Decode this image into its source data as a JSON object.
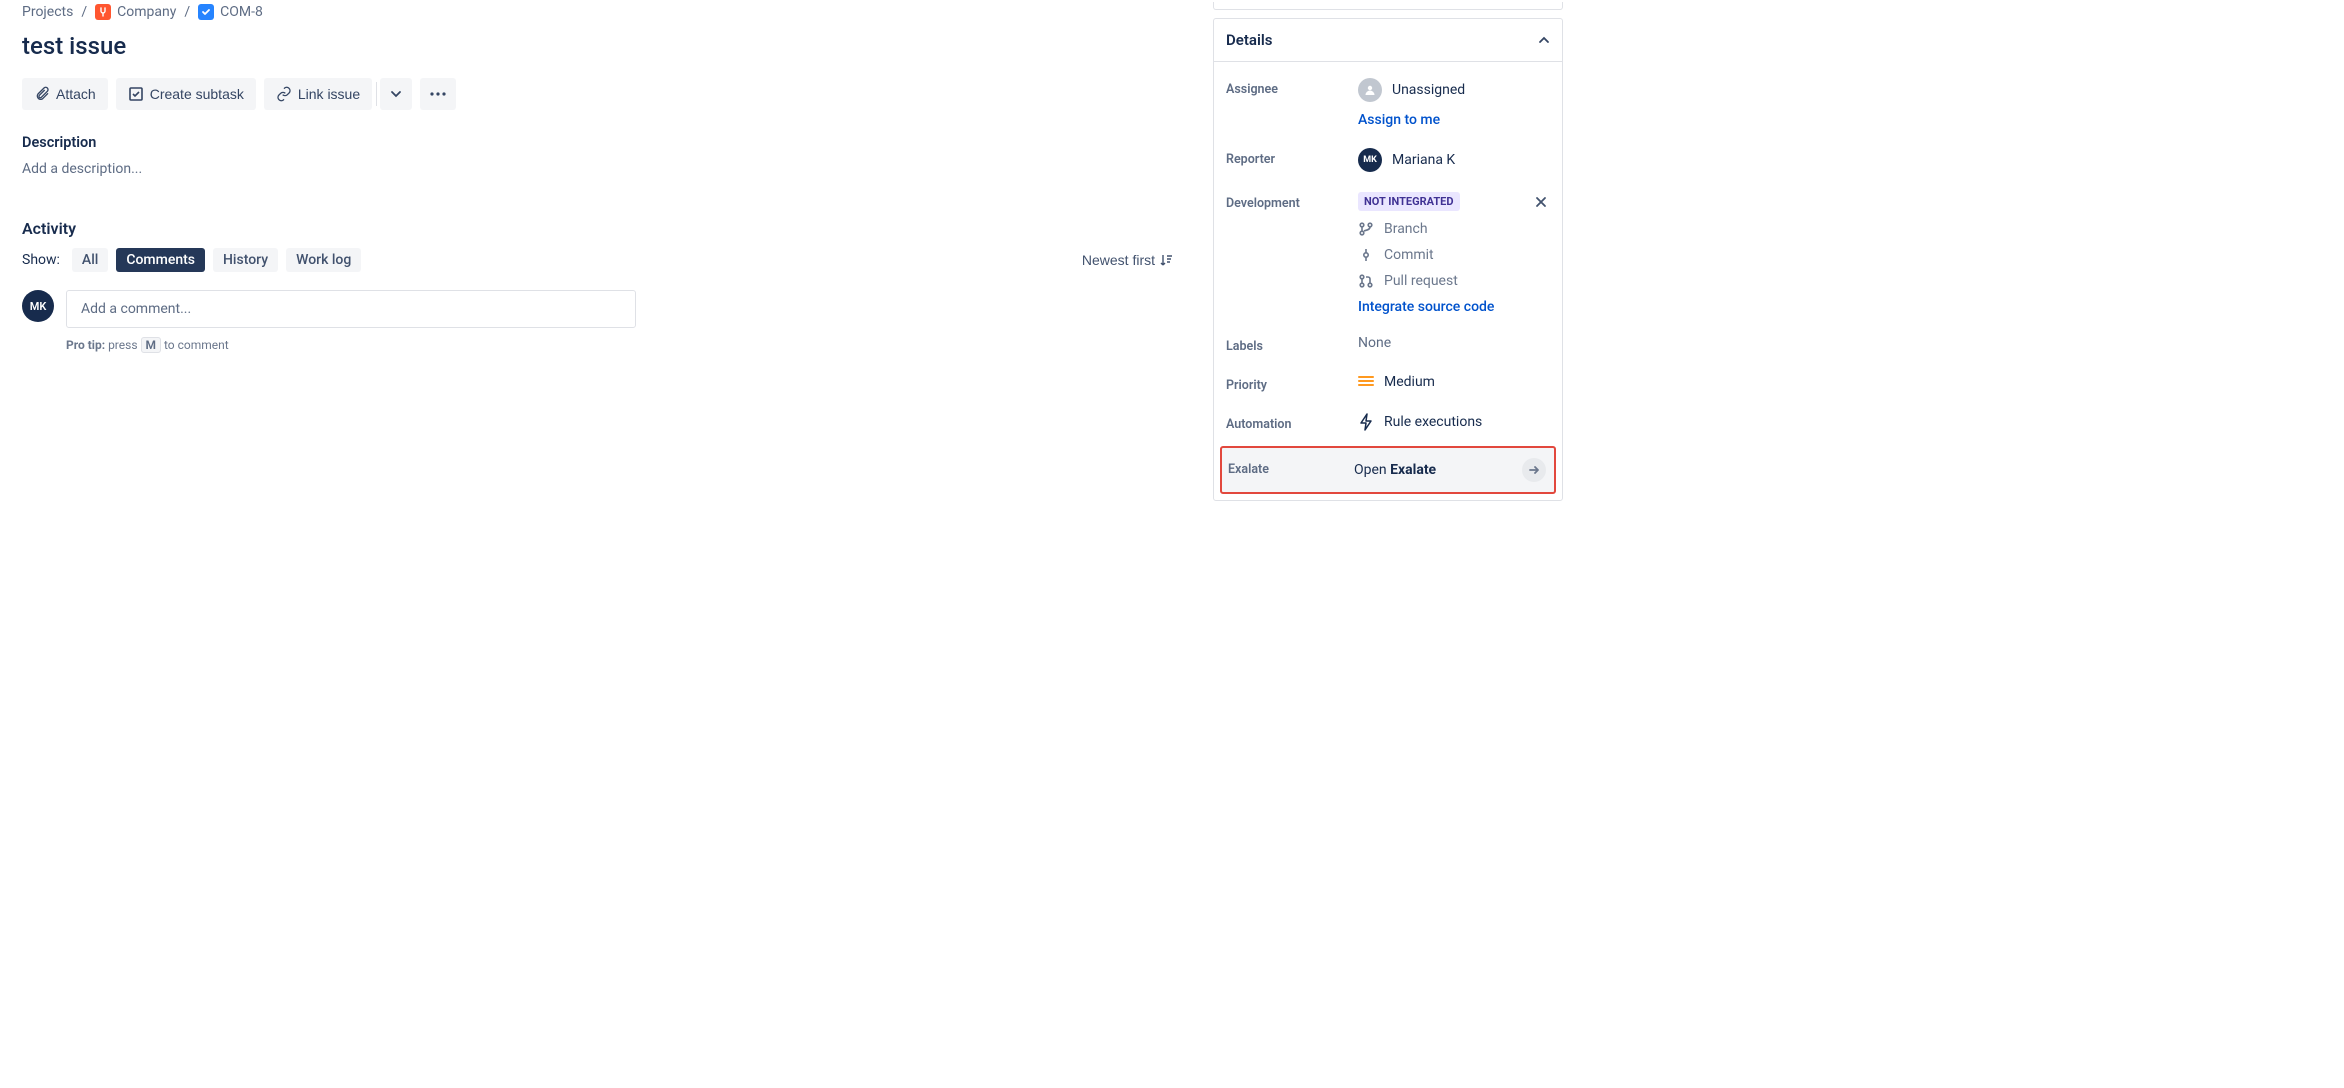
{
  "breadcrumb": {
    "projects": "Projects",
    "project_name": "Company",
    "issue_key": "COM-8"
  },
  "issue": {
    "title": "test issue"
  },
  "toolbar": {
    "attach": "Attach",
    "create_subtask": "Create subtask",
    "link_issue": "Link issue"
  },
  "description": {
    "label": "Description",
    "placeholder": "Add a description..."
  },
  "activity": {
    "title": "Activity",
    "show_label": "Show:",
    "tabs": {
      "all": "All",
      "comments": "Comments",
      "history": "History",
      "worklog": "Work log"
    },
    "sort": "Newest first",
    "comment_placeholder": "Add a comment...",
    "pro_tip_label": "Pro tip:",
    "pro_tip_before": "press",
    "pro_tip_key": "M",
    "pro_tip_after": "to comment",
    "avatar_initials": "MK"
  },
  "details": {
    "title": "Details",
    "assignee": {
      "label": "Assignee",
      "value": "Unassigned",
      "assign_to_me": "Assign to me"
    },
    "reporter": {
      "label": "Reporter",
      "value": "Mariana K",
      "initials": "MK"
    },
    "development": {
      "label": "Development",
      "badge": "NOT INTEGRATED",
      "branch": "Branch",
      "commit": "Commit",
      "pull_request": "Pull request",
      "integrate": "Integrate source code"
    },
    "labels": {
      "label": "Labels",
      "value": "None"
    },
    "priority": {
      "label": "Priority",
      "value": "Medium"
    },
    "automation": {
      "label": "Automation",
      "value": "Rule executions"
    },
    "exalate": {
      "label": "Exalate",
      "prefix": "Open ",
      "name": "Exalate"
    }
  }
}
